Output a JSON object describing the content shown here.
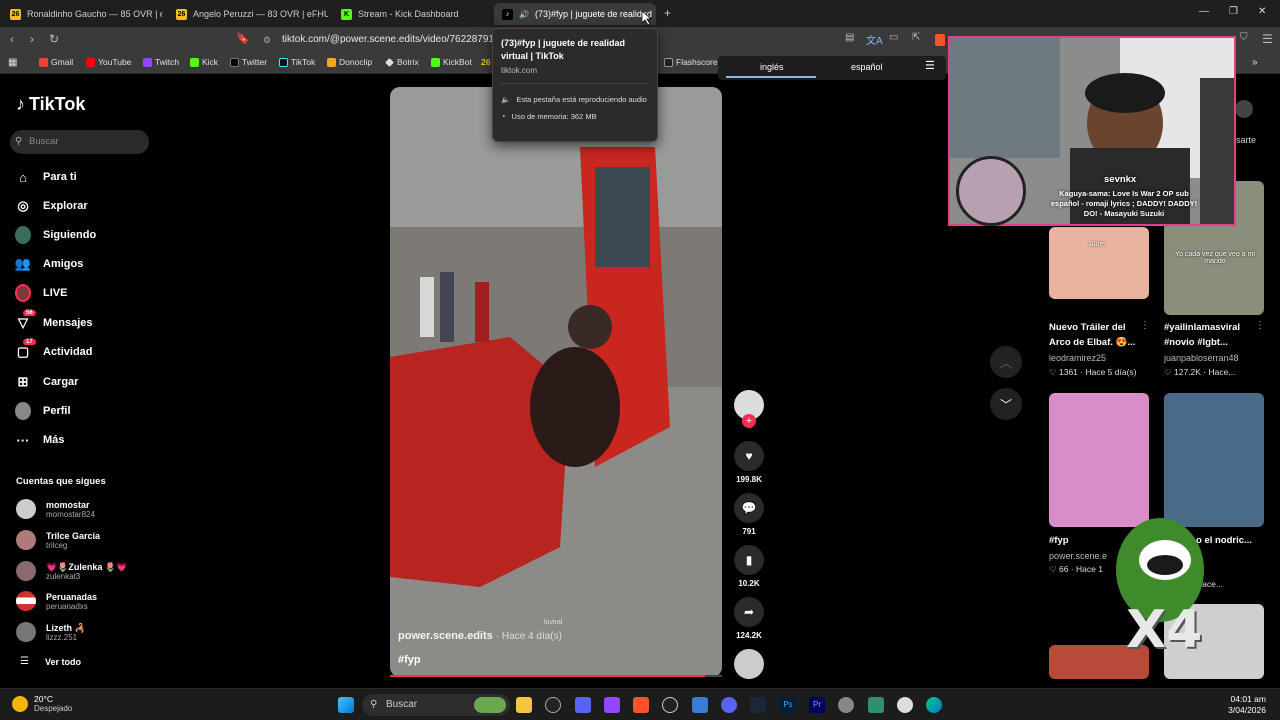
{
  "browser": {
    "tabs": [
      {
        "label": "Ronaldinho Gaucho — 85 OVR | eFH",
        "favicon": "26"
      },
      {
        "label": "Angelo Peruzzi — 83 OVR | eFHUB",
        "favicon": "26"
      },
      {
        "label": "Stream - Kick Dashboard",
        "favicon": "kick-icon"
      },
      {
        "label": "(73)#fyp | juguete de realidad",
        "favicon": "tiktok-icon"
      }
    ],
    "url": "tiktok.com/@power.scene.edits/video/7622879128",
    "bookmarks": [
      "Gmail",
      "YouTube",
      "Twitch",
      "Kick",
      "Twitter",
      "TikTok",
      "Donoclip",
      "Botrix",
      "KickBot",
      "26",
      "Flashscore"
    ],
    "tab_tooltip": {
      "title": "(73)#fyp | juguete de realidad virtual | TikTok",
      "domain": "tiktok.com",
      "audio": "Esta pestaña está reproduciendo audio",
      "memory": "Uso de memoria: 362 MB"
    },
    "translate": {
      "from": "inglés",
      "to": "español"
    }
  },
  "tiktok": {
    "logo": "TikTok",
    "search_placeholder": "Buscar",
    "nav": [
      {
        "label": "Para ti",
        "icon": "home-icon"
      },
      {
        "label": "Explorar",
        "icon": "compass-icon"
      },
      {
        "label": "Siguiendo",
        "icon": "following-icon"
      },
      {
        "label": "Amigos",
        "icon": "friends-icon"
      },
      {
        "label": "LIVE",
        "icon": "live-icon"
      },
      {
        "label": "Mensajes",
        "icon": "messages-icon",
        "badge": "56"
      },
      {
        "label": "Actividad",
        "icon": "activity-icon",
        "badge": "17"
      },
      {
        "label": "Cargar",
        "icon": "upload-icon"
      },
      {
        "label": "Perfil",
        "icon": "profile-icon"
      },
      {
        "label": "Más",
        "icon": "more-icon"
      }
    ],
    "following_title": "Cuentas que sigues",
    "following": [
      {
        "name": "momostar",
        "handle": "momostar824"
      },
      {
        "name": "Trilce García",
        "handle": "trilceg"
      },
      {
        "name": "💗🌷Zulenka 🌷💗",
        "handle": "zulenkat3"
      },
      {
        "name": "Peruanadas",
        "handle": "peruanadxs"
      },
      {
        "name": "Lizeth 🦂",
        "handle": "lizzz.251"
      }
    ],
    "see_all": "Ver todo",
    "video": {
      "author": "power.scene.edits",
      "time": "· Hace 4 día(s)",
      "caption": "#fyp",
      "watermark": "loviral",
      "progress": 0.95
    },
    "actions": [
      {
        "icon": "heart-icon",
        "count": "199.8K"
      },
      {
        "icon": "comment-icon",
        "count": "791"
      },
      {
        "icon": "bookmark-icon",
        "count": "10.2K"
      },
      {
        "icon": "share-icon",
        "count": "124.2K"
      }
    ],
    "cards": [
      {
        "title": "Nuevo Tráiler del Arco de Elbaf. 😍...",
        "user": "leodramirez25",
        "likes": "1361",
        "time": "Hace 5 día(s)",
        "caption_overlay": "Aure:"
      },
      {
        "title": "#yailinlamasviral #novio #lgbt...",
        "user": "juanpabloserran48",
        "likes": "127.2K",
        "time": "Hace...",
        "caption_overlay": "Yo cada vez que veo a mi marido"
      },
      {
        "title": "#fyp",
        "user": "power.scene.e",
        "likes": "66",
        "time": "Hace 1"
      },
      {
        "title": "o el nodric...",
        "user": "",
        "likes": "",
        "time": "Hace..."
      }
    ],
    "partial_label": "sarte",
    "x4": "X4"
  },
  "stream_overlay": {
    "username": "sevnkx",
    "song": "Kaguya-sama: Love Is War 2 OP sub español - romaji lyrics ; DADDY! DADDY! DO! - Masayuki Suzuki"
  },
  "taskbar": {
    "weather_temp": "20°C",
    "weather_desc": "Despejado",
    "search": "Buscar",
    "time": "04:01 am",
    "date": "3/04/2026"
  }
}
